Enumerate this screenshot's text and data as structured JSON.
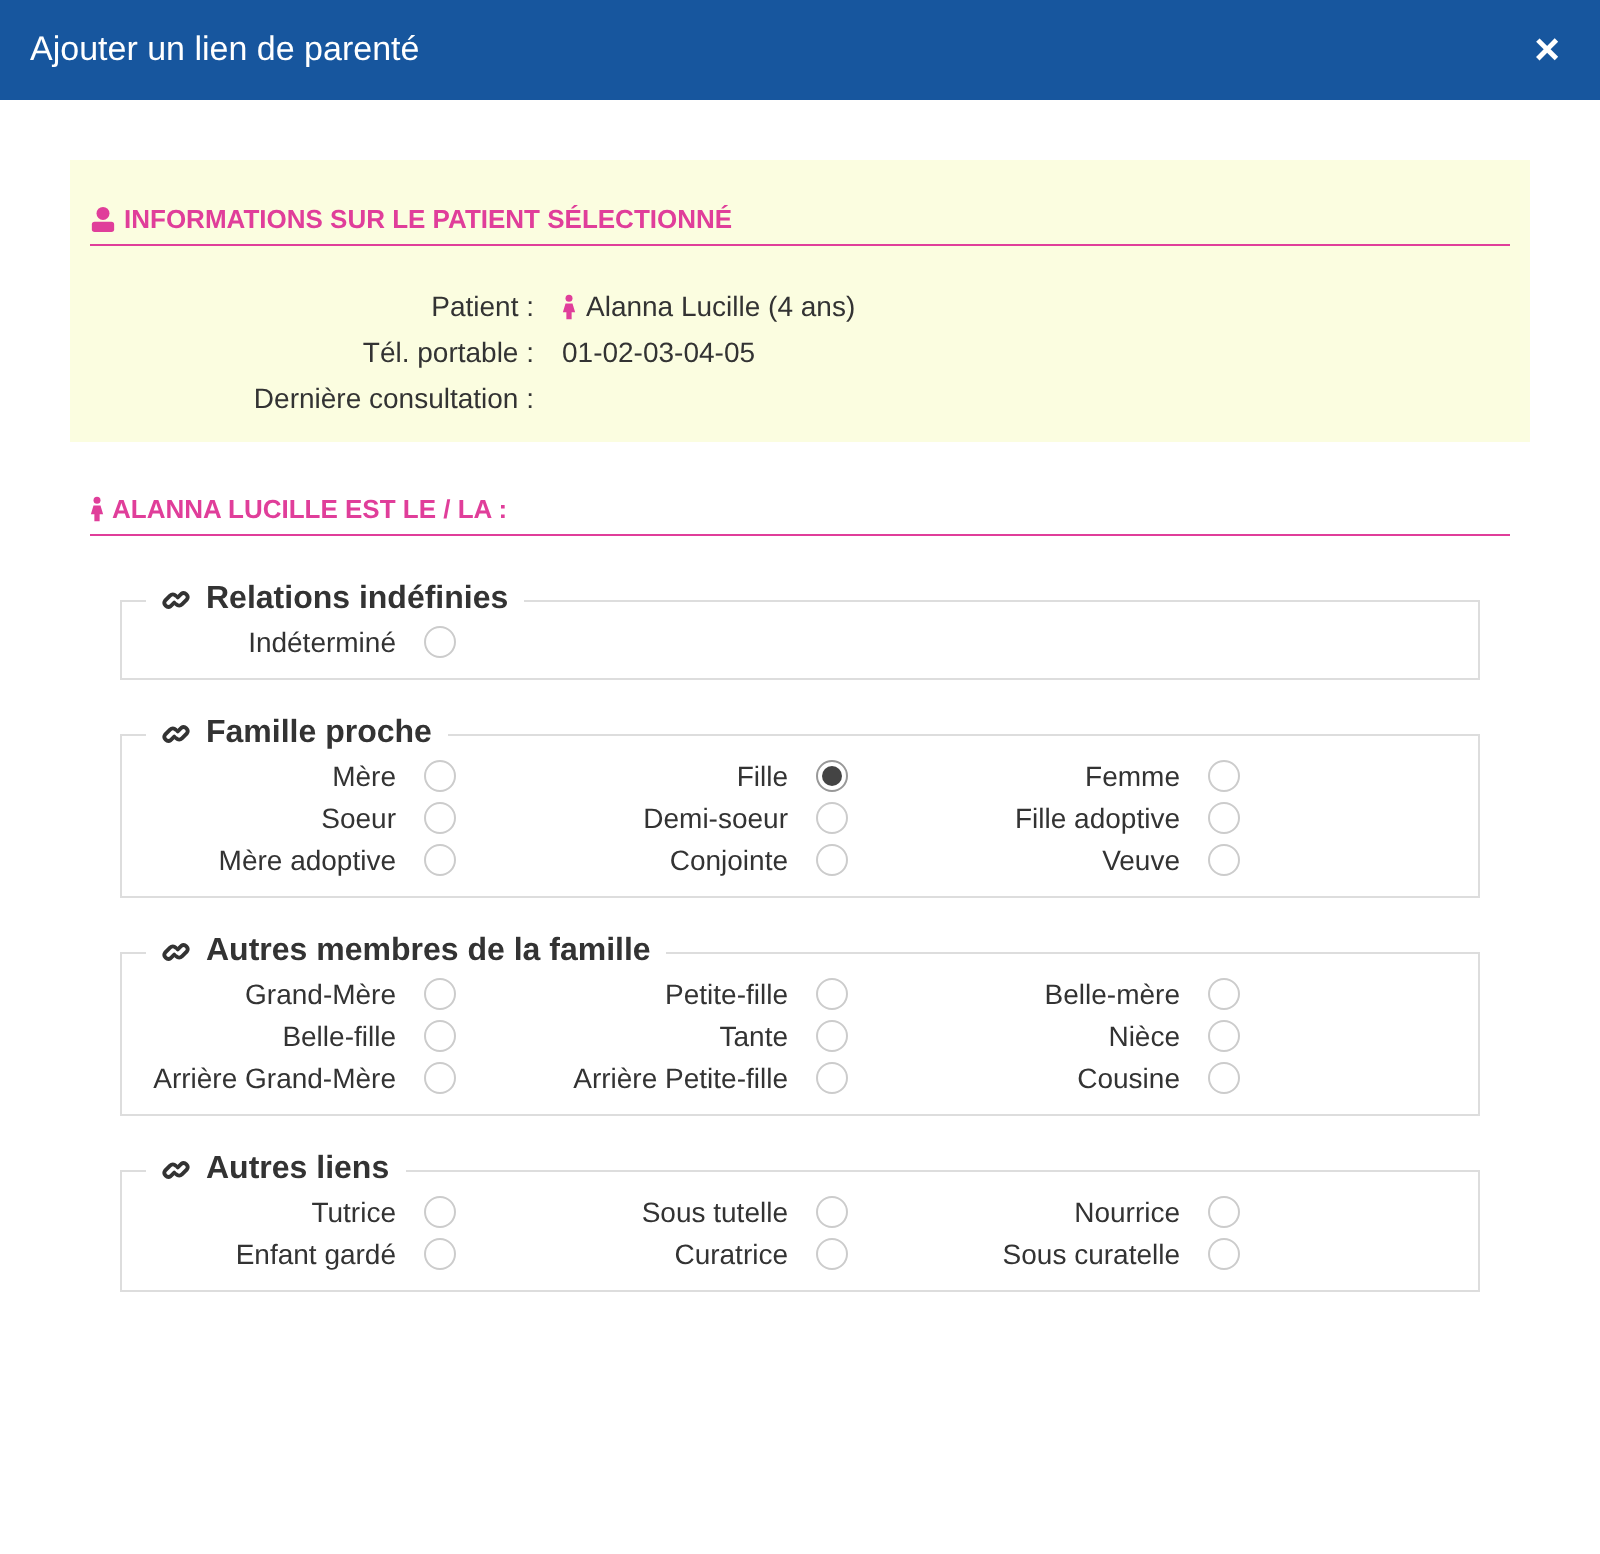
{
  "window": {
    "title": "Ajouter un lien de parenté",
    "close": "×"
  },
  "patient_info": {
    "heading": "INFORMATIONS SUR LE PATIENT SÉLECTIONNÉ",
    "fields": [
      {
        "label": "Patient :",
        "value": "Alanna Lucille (4 ans)",
        "kind": "person"
      },
      {
        "label": "Tél. portable :",
        "value": "01-02-03-04-05",
        "kind": "text"
      },
      {
        "label": "Dernière consultation :",
        "kind": "text"
      }
    ]
  },
  "relations": {
    "heading": "ALANNA LUCILLE EST LE / LA :",
    "groups": [
      {
        "title": "Relations indéfinies",
        "options": [
          {
            "label": "Indéterminé",
            "selected": false
          }
        ]
      },
      {
        "title": "Famille proche",
        "options": [
          {
            "label": "Mère",
            "selected": false
          },
          {
            "label": "Fille",
            "selected": true
          },
          {
            "label": "Femme",
            "selected": false
          },
          {
            "label": "Soeur",
            "selected": false
          },
          {
            "label": "Demi-soeur",
            "selected": false
          },
          {
            "label": "Fille adoptive",
            "selected": false
          },
          {
            "label": "Mère adoptive",
            "selected": false
          },
          {
            "label": "Conjointe",
            "selected": false
          },
          {
            "label": "Veuve",
            "selected": false
          }
        ]
      },
      {
        "title": "Autres membres de la famille",
        "options": [
          {
            "label": "Grand-Mère",
            "selected": false
          },
          {
            "label": "Petite-fille",
            "selected": false
          },
          {
            "label": "Belle-mère",
            "selected": false
          },
          {
            "label": "Belle-fille",
            "selected": false
          },
          {
            "label": "Tante",
            "selected": false
          },
          {
            "label": "Nièce",
            "selected": false
          },
          {
            "label": "Arrière Grand-Mère",
            "selected": false
          },
          {
            "label": "Arrière Petite-fille",
            "selected": false
          },
          {
            "label": "Cousine",
            "selected": false
          }
        ]
      },
      {
        "title": "Autres liens",
        "options": [
          {
            "label": "Tutrice",
            "selected": false
          },
          {
            "label": "Sous tutelle",
            "selected": false
          },
          {
            "label": "Nourrice",
            "selected": false
          },
          {
            "label": "Enfant gardé",
            "selected": false
          },
          {
            "label": "Curatrice",
            "selected": false
          },
          {
            "label": "Sous curatelle",
            "selected": false
          }
        ]
      }
    ]
  }
}
